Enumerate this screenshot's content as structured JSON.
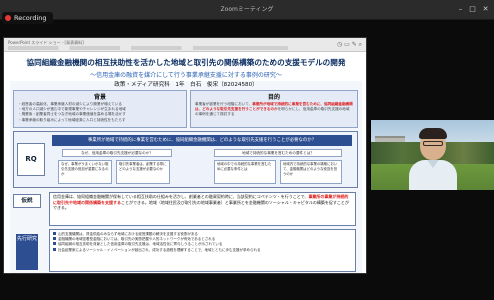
{
  "window": {
    "title": "Zoomミーティング",
    "minimize_glyph": "–",
    "maximize_glyph": "□",
    "close_glyph": "✕"
  },
  "recording": {
    "label": "Recording",
    "color": "#e53935"
  },
  "app": {
    "menu_text": "PowerPoint スライド ショー - [発表資料]",
    "toolbar_icons": "◷ ▭ ✎ ⌕"
  },
  "slide": {
    "title": "協同組織金融機関の相互扶助性を活かした地域と取引先の関係構築のための支援モデルの開発",
    "subtitle": "～信用金庫の融資を媒介にして行う事業承継支援に対する事例の研究～",
    "author": "政策・メディア研究科　1年　白石　俊宋（82024580）",
    "background": {
      "heading": "背景",
      "lines": [
        "・経営者の高齢化、事業承継人材の減少により廃業が増えている",
        "・地方の人口減少が進む中で新規事業やチャレンジが生まれる地域",
        "・廃業後・創業者同士をつなぎ地域の事業価値を高める場を活かす",
        "・事業承継の取り組みによって地域経済に人口と持続性をもたらす"
      ]
    },
    "aim": {
      "heading": "目的",
      "lines": [
        "事業者が創業を行う段階において、",
        "事業所が地域で持続的に事業を営むために、協同組織金融機関は、どのような取引先支援を行うことができるのか",
        "を明らかにし、信用金庫の取引先支援の地域の事例を通じて検討する"
      ]
    },
    "rq": {
      "label": "RQ",
      "main": "事業所が地域で持続的に事業を営むために、協同組織金融機関は、どのような取引先支援を行うことが必要なのか？",
      "sub_left": "なぜ、信用金庫の取引先支援が必要なのか？",
      "sub_right": "地域で持続的な事業を営むための要件とは？",
      "questions": [
        "なぜ、事業がうまくいかない取引先支援の役割が重要になるのか",
        "取引先事業者は、創業する際にどのような支援が必要なのか",
        "地域の中での持続的な事業を営むために必要な条件とは",
        "地域内で持続的な事業の構築において、金融機関はどのような役割を担うのか"
      ]
    },
    "hypothesis": {
      "label": "仮説",
      "text": "信用金庫は、協同組織金融機関が保有している相互扶助の仕組みを活かし、創業者との融資契約時に、当該契約にコペテンツ・を行うことで、",
      "highlight": "事業所の事業が持続的に取引先や地域の関係構築を支援する",
      "text2": "ことができる。地域（地域住民及び取引先の地域事業者）と事業所とを金融機関のソーシャル・キャピタルの構築を促すことができる。"
    },
    "prior": {
      "label": "先行研究",
      "items": [
        "山的支援機関は、資金供給のみならず地域における経営課題の解決を支援する役割がある",
        "金融機関の地域密着型金融においては、取引先の実態把握や人的ネットワークが有効であるとされる",
        "協同組織の相互扶助を背景とした信用金庫の取引先支援は、地域活性化に寄与しうることが示されている",
        "社会起業家によるソーシャル・イノベーションが創出され、成功する過程を理解することで、地域とともに歩む支援が求められる"
      ]
    }
  },
  "video": {
    "participant": "speaker"
  }
}
